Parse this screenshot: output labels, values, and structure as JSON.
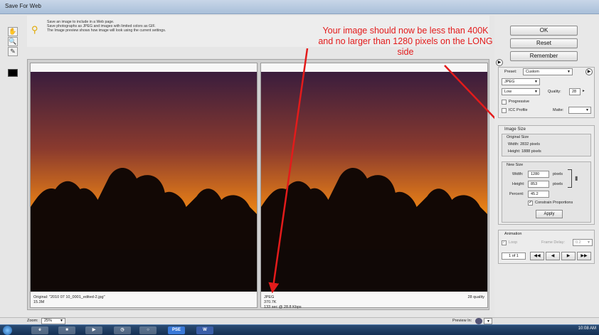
{
  "window": {
    "title": "Save For Web"
  },
  "tools": [
    {
      "icon": "hand-icon",
      "glyph": "✋"
    },
    {
      "icon": "zoom-icon",
      "glyph": "🔍"
    },
    {
      "icon": "eyedropper-icon",
      "glyph": "✎"
    }
  ],
  "info": {
    "line1": "Save an image to include in a Web page.",
    "line2": "Save photographs as JPEG and images with limited colors as GIF.",
    "line3": "The Image preview shows how image will look using the current settings."
  },
  "annotation": {
    "text": "Your image should now be less than 400K and no larger than 1280 pixels on the LONG side",
    "color": "#e31b1b"
  },
  "preview": {
    "left": {
      "line1": "Original: \"2010 07 10_0001_edited-2.jpg\"",
      "line2": "15.3M"
    },
    "right": {
      "line1": "JPEG",
      "line2": "370.7K",
      "line3": "133 sec @ 28.8 Kbps",
      "quality": "28 quality"
    }
  },
  "buttons": {
    "ok": "OK",
    "reset": "Reset",
    "remember": "Remember"
  },
  "settings": {
    "preset_label": "Preset:",
    "preset_value": "Custom",
    "format": "JPEG",
    "compression": "Low",
    "quality_label": "Quality:",
    "quality_value": "28",
    "progressive": "Progressive",
    "icc_profile": "ICC Profile",
    "matte": "Matte:"
  },
  "image_size": {
    "title": "Image Size",
    "original_title": "Original Size",
    "orig_width": "Width: 2832 pixels",
    "orig_height": "Height: 1888 pixels",
    "new_title": "New Size",
    "width_label": "Width:",
    "width_value": "1280",
    "height_label": "Height:",
    "height_value": "853",
    "pixels": "pixels",
    "percent_label": "Percent:",
    "percent_value": "45.2",
    "constrain": "Constrain Proportions",
    "apply": "Apply"
  },
  "animation": {
    "title": "Animation",
    "loop": "Loop",
    "frame_delay_label": "Frame Delay:",
    "frame_delay_value": "0.2",
    "frame_counter": "1 of 1"
  },
  "bottom": {
    "zoom_label": "Zoom:",
    "zoom_value": "25%",
    "preview_in": "Preview In:"
  },
  "taskbar": {
    "clock": "10:08 AM",
    "apps": [
      "PSE",
      "W"
    ]
  }
}
